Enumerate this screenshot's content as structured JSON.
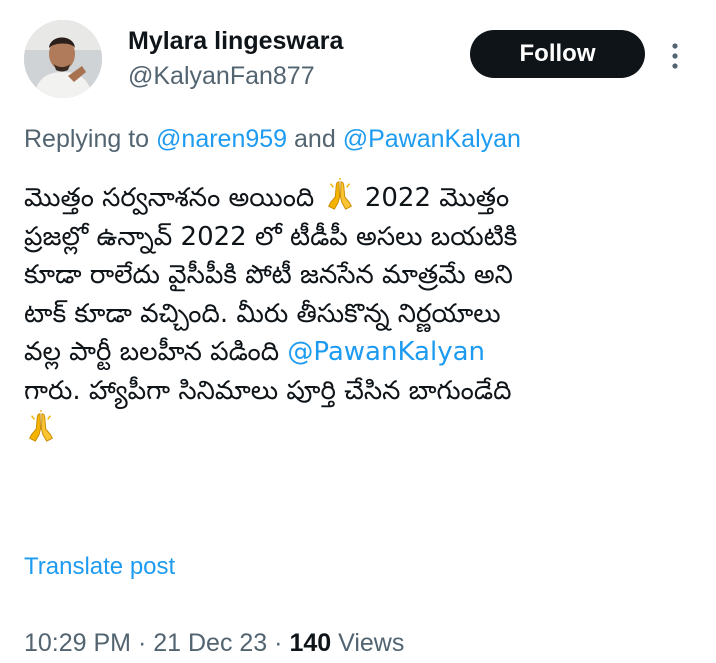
{
  "author": {
    "display_name": "Mylara lingeswara",
    "handle": "@KalyanFan877",
    "avatar_icon": "profile-photo"
  },
  "follow_button": {
    "label": "Follow"
  },
  "more_icon": "more-vertical-icon",
  "reply": {
    "prefix": "Replying to",
    "mention_1": "@naren959",
    "conjunction": "and",
    "mention_2": "@PawanKalyan"
  },
  "post": {
    "line_1": "మొత్తం సర్వనాశనం అయింది",
    "line_1_tail": "2022 మొత్తం",
    "line_2": "ప్రజల్లో ఉన్నావ్ 2022 లో టీడీపీ అసలు బయటికి",
    "line_3": "కూడా రాలేదు వైసీపీకి పోటీ జనసేన మాత్రమే అని",
    "line_4": "టాక్ కూడా వచ్చింది. మీరు తీసుకొన్న నిర్ణయాలు",
    "line_5": "వల్ల పార్టీ బలహీన పడింది",
    "line_5_mention": "@PawanKalyan",
    "line_6": "గారు. హ్యాపీగా సినిమాలు పూర్తి చేసిన బాగుండేది",
    "emoji": "folded-hands-emoji",
    "emoji_color": "#f4b400"
  },
  "translate_label": "Translate post",
  "meta": {
    "time": "10:29 PM",
    "separator": "·",
    "date": "21 Dec 23",
    "views_count": "140",
    "views_label": "Views"
  },
  "colors": {
    "text_primary": "#0f1419",
    "text_secondary": "#536471",
    "link": "#1d9bf0",
    "button_bg": "#0f1419"
  }
}
